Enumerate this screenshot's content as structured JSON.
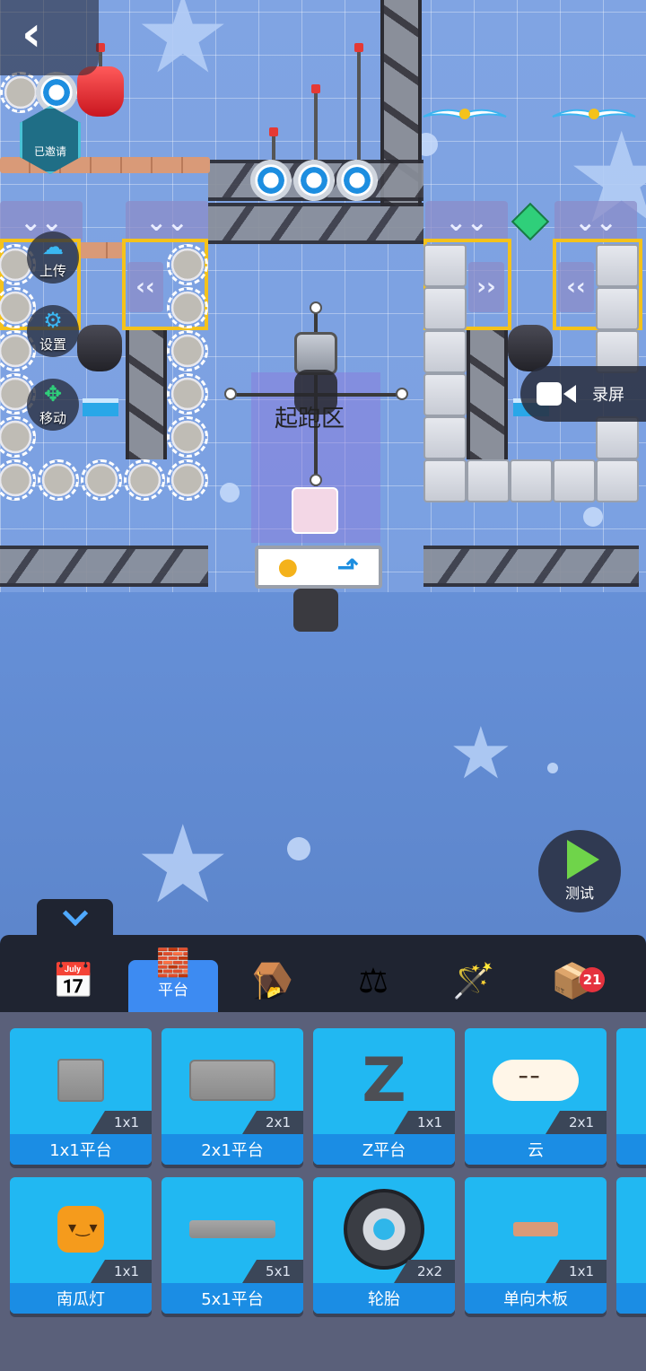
{
  "canvas": {
    "start_zone_label": "起跑区"
  },
  "overlay": {
    "back_icon": "chevron-left",
    "avatar_badge_text": "已邀请",
    "side_tools": [
      {
        "id": "upload",
        "label": "上传",
        "icon": "cloud-upload"
      },
      {
        "id": "settings",
        "label": "设置",
        "icon": "gear"
      },
      {
        "id": "move",
        "label": "移动",
        "icon": "move-arrows"
      }
    ],
    "record_label": "录屏",
    "test_label": "测试"
  },
  "tabs": {
    "items": [
      {
        "id": "calendar",
        "icon": "calendar-star",
        "label": ""
      },
      {
        "id": "platform",
        "icon": "brick",
        "label": "平台",
        "active": true
      },
      {
        "id": "trap",
        "icon": "trap-jaw",
        "label": ""
      },
      {
        "id": "seesaw",
        "icon": "seesaw",
        "label": ""
      },
      {
        "id": "wand",
        "icon": "magic-wand",
        "label": ""
      },
      {
        "id": "box",
        "icon": "cardboard-box",
        "label": "",
        "badge": "21"
      }
    ]
  },
  "palette": {
    "row1": [
      {
        "name": "1x1平台",
        "size": "1x1",
        "art": "block"
      },
      {
        "name": "2x1平台",
        "size": "2x1",
        "art": "wide"
      },
      {
        "name": "Z平台",
        "size": "1x1",
        "art": "z"
      },
      {
        "name": "云",
        "size": "2x1",
        "art": "cloud"
      }
    ],
    "row2": [
      {
        "name": "南瓜灯",
        "size": "1x1",
        "art": "pumpkin"
      },
      {
        "name": "5x1平台",
        "size": "5x1",
        "art": "long"
      },
      {
        "name": "轮胎",
        "size": "2x2",
        "art": "tire"
      },
      {
        "name": "单向木板",
        "size": "1x1",
        "art": "plank"
      }
    ]
  }
}
